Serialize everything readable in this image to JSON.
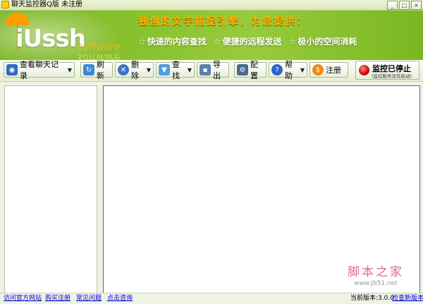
{
  "window": {
    "title": "聊天监控器Q版 未注册",
    "min_label": "_",
    "max_label": "□",
    "close_label": "×"
  },
  "banner": {
    "logo_text": "iUssh",
    "logo_sub": "software",
    "slogan": "独创的文字捕捉引擎，为您提供：",
    "features": [
      "快速的内容查找",
      "便捷的远程发送",
      "极小的空间消耗"
    ],
    "feature_star": "☆"
  },
  "toolbar": {
    "view_chat": "查看聊天记录",
    "refresh": "刷新",
    "delete": "删除",
    "search": "查找",
    "export": "导出",
    "settings": "配置",
    "help": "帮助",
    "register": "注册",
    "stop_main": "监控已停止",
    "stop_sub": "(监控服务没有启动)",
    "dropdown_arrow": "▼"
  },
  "watermark": {
    "main": "脚本之家",
    "url": "www.jb51.net"
  },
  "statusbar": {
    "links": [
      "访问官方网站",
      "购买注册",
      "常见问题",
      "点击咨询"
    ],
    "version_label": "当前版本:3.0.0",
    "check_update": "检查新版本"
  },
  "colors": {
    "banner_green": "#8ac22e",
    "slogan_orange": "#ffb400",
    "link_blue": "#0000cc",
    "stop_red": "#d40000"
  }
}
